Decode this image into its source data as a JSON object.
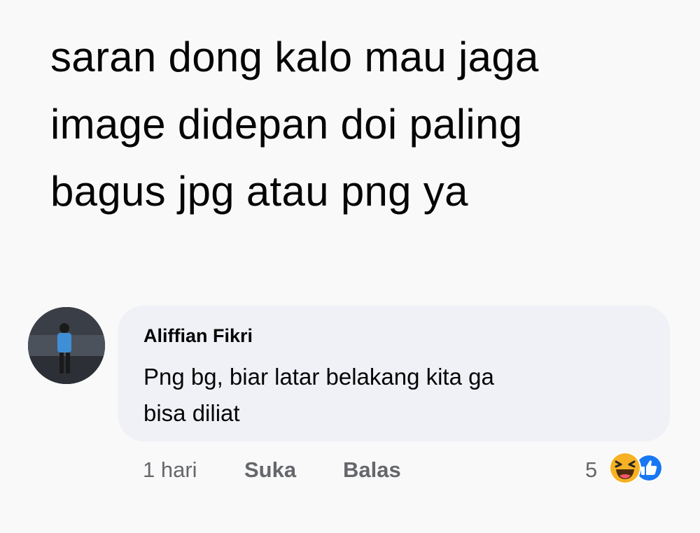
{
  "post": {
    "lines": [
      "saran dong kalo mau jaga",
      "image didepan doi paling",
      "bagus jpg atau png ya"
    ]
  },
  "comment": {
    "author": "Aliffian Fikri",
    "lines": [
      "Png bg, biar latar belakang kita ga",
      "bisa diliat"
    ],
    "actions": {
      "time": "1 hari",
      "like": "Suka",
      "reply": "Balas"
    },
    "reactions": {
      "count": "5",
      "icons": [
        "haha-icon",
        "like-icon"
      ]
    }
  },
  "colors": {
    "background": "#f9f9f9",
    "bubble": "#eff1f6",
    "text": "#050505",
    "secondary_text": "#65676b",
    "like_blue": "#1877f2",
    "haha_yellow": "#f7b125"
  }
}
